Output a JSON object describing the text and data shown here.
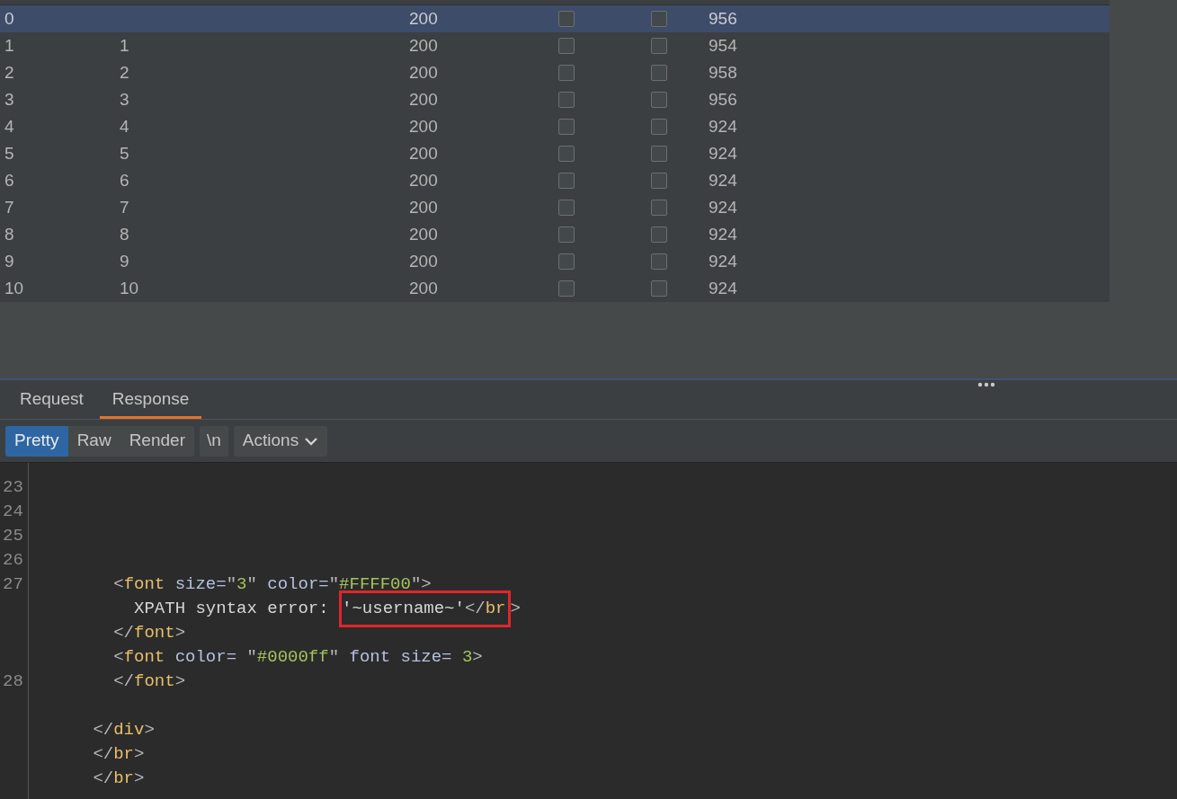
{
  "results_table": {
    "rows": [
      {
        "request": "0",
        "payload": "",
        "status": "200",
        "error": false,
        "timeout": false,
        "length": "956",
        "selected": true
      },
      {
        "request": "1",
        "payload": "1",
        "status": "200",
        "error": false,
        "timeout": false,
        "length": "954",
        "selected": false
      },
      {
        "request": "2",
        "payload": "2",
        "status": "200",
        "error": false,
        "timeout": false,
        "length": "958",
        "selected": false
      },
      {
        "request": "3",
        "payload": "3",
        "status": "200",
        "error": false,
        "timeout": false,
        "length": "956",
        "selected": false
      },
      {
        "request": "4",
        "payload": "4",
        "status": "200",
        "error": false,
        "timeout": false,
        "length": "924",
        "selected": false
      },
      {
        "request": "5",
        "payload": "5",
        "status": "200",
        "error": false,
        "timeout": false,
        "length": "924",
        "selected": false
      },
      {
        "request": "6",
        "payload": "6",
        "status": "200",
        "error": false,
        "timeout": false,
        "length": "924",
        "selected": false
      },
      {
        "request": "7",
        "payload": "7",
        "status": "200",
        "error": false,
        "timeout": false,
        "length": "924",
        "selected": false
      },
      {
        "request": "8",
        "payload": "8",
        "status": "200",
        "error": false,
        "timeout": false,
        "length": "924",
        "selected": false
      },
      {
        "request": "9",
        "payload": "9",
        "status": "200",
        "error": false,
        "timeout": false,
        "length": "924",
        "selected": false
      },
      {
        "request": "10",
        "payload": "10",
        "status": "200",
        "error": false,
        "timeout": false,
        "length": "924",
        "selected": false
      }
    ]
  },
  "message_tabs": [
    {
      "label": "Request",
      "selected": false
    },
    {
      "label": "Response",
      "selected": true
    }
  ],
  "view_modes": [
    {
      "label": "Pretty",
      "selected": true
    },
    {
      "label": "Raw",
      "selected": false
    },
    {
      "label": "Render",
      "selected": false
    }
  ],
  "newline_button": "\\n",
  "actions_button": "Actions",
  "editor": {
    "lines": [
      {
        "number": "23"
      },
      {
        "number": "24"
      },
      {
        "number": "25"
      },
      {
        "number": "26"
      },
      {
        "number": "27",
        "segments": [
          {
            "kind": "punct",
            "text": "        <"
          },
          {
            "kind": "tag",
            "text": "font"
          },
          {
            "kind": "attr",
            "text": " size="
          },
          {
            "kind": "punct",
            "text": "\""
          },
          {
            "kind": "value",
            "text": "3"
          },
          {
            "kind": "punct",
            "text": "\""
          },
          {
            "kind": "attr",
            "text": " color="
          },
          {
            "kind": "punct",
            "text": "\""
          },
          {
            "kind": "value",
            "text": "#FFFF00"
          },
          {
            "kind": "punct",
            "text": "\">"
          }
        ]
      },
      {
        "segments": [
          {
            "kind": "text",
            "text": "          XPATH syntax error: "
          }
        ],
        "highlighted": [
          {
            "kind": "text",
            "text": "'~username~'"
          },
          {
            "kind": "punct",
            "text": "</"
          },
          {
            "kind": "tag",
            "text": "br"
          }
        ],
        "after": [
          {
            "kind": "punct",
            "text": ">"
          }
        ]
      },
      {
        "segments": [
          {
            "kind": "punct",
            "text": "        </"
          },
          {
            "kind": "tag",
            "text": "font"
          },
          {
            "kind": "punct",
            "text": ">"
          }
        ]
      },
      {
        "segments": [
          {
            "kind": "punct",
            "text": "        <"
          },
          {
            "kind": "tag",
            "text": "font"
          },
          {
            "kind": "attr",
            "text": " color= "
          },
          {
            "kind": "punct",
            "text": "\""
          },
          {
            "kind": "value",
            "text": "#0000ff"
          },
          {
            "kind": "punct",
            "text": "\""
          },
          {
            "kind": "attr",
            "text": " font size= "
          },
          {
            "kind": "value",
            "text": "3"
          },
          {
            "kind": "punct",
            "text": ">"
          }
        ]
      },
      {
        "number": "28",
        "segments": [
          {
            "kind": "punct",
            "text": "        </"
          },
          {
            "kind": "tag",
            "text": "font"
          },
          {
            "kind": "punct",
            "text": ">"
          }
        ]
      },
      {
        "gap_before": true,
        "segments": [
          {
            "kind": "punct",
            "text": "      </"
          },
          {
            "kind": "tag",
            "text": "div"
          },
          {
            "kind": "punct",
            "text": ">"
          }
        ]
      },
      {
        "segments": [
          {
            "kind": "punct",
            "text": "      </"
          },
          {
            "kind": "tag",
            "text": "br"
          },
          {
            "kind": "punct",
            "text": ">"
          }
        ]
      },
      {
        "segments": [
          {
            "kind": "punct",
            "text": "      </"
          },
          {
            "kind": "tag",
            "text": "br"
          },
          {
            "kind": "punct",
            "text": ">"
          }
        ]
      }
    ]
  }
}
